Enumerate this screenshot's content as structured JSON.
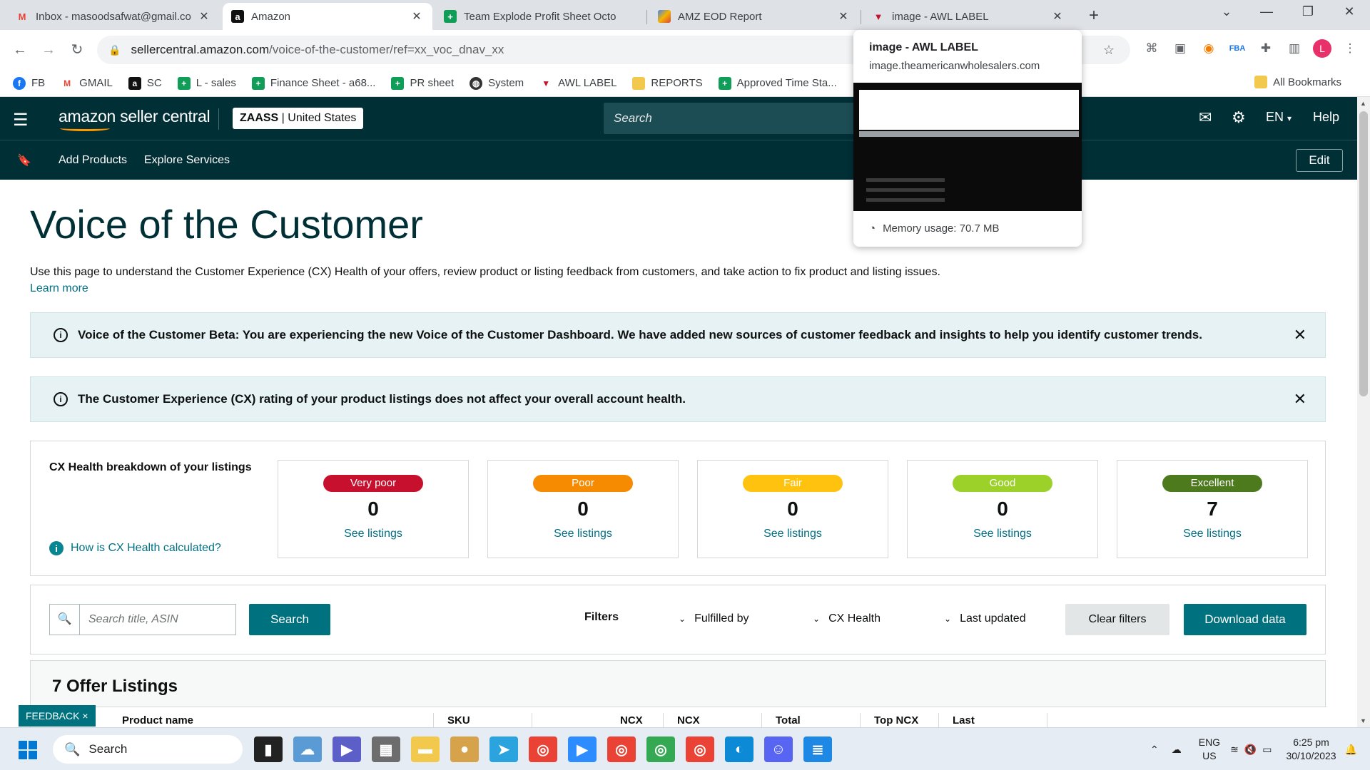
{
  "tabs": [
    {
      "title": "Inbox - masoodsafwat@gmail.com",
      "favicon": "gmail-icon",
      "active": false
    },
    {
      "title": "Amazon",
      "favicon": "amazon-icon",
      "active": true
    },
    {
      "title": "Team Explode Profit Sheet Octob",
      "favicon": "sheets-icon",
      "active": false
    },
    {
      "title": "AMZ EOD Report",
      "favicon": "report-icon",
      "active": false
    },
    {
      "title": "image - AWL LABEL",
      "favicon": "awl-icon",
      "active": false
    }
  ],
  "address": {
    "host": "sellercentral.amazon.com",
    "path": "/voice-of-the-customer/ref=xx_voc_dnav_xx"
  },
  "bookmarks": [
    {
      "label": "FB",
      "icon": "facebook-icon",
      "color": "#1877f2"
    },
    {
      "label": "GMAIL",
      "icon": "gmail-icon",
      "color": "#ea4335"
    },
    {
      "label": "SC",
      "icon": "amazon-icon",
      "color": "#111111"
    },
    {
      "label": "L - sales",
      "icon": "sheets-icon",
      "color": "#0f9d58"
    },
    {
      "label": "Finance Sheet - a68...",
      "icon": "sheets-icon",
      "color": "#0f9d58"
    },
    {
      "label": "PR sheet",
      "icon": "sheets-icon",
      "color": "#0f9d58"
    },
    {
      "label": "System",
      "icon": "globe-icon",
      "color": "#333333"
    },
    {
      "label": "AWL LABEL",
      "icon": "awl-icon",
      "color": "#c4122f"
    },
    {
      "label": "REPORTS",
      "icon": "folder-icon",
      "color": "#f2c94c"
    },
    {
      "label": "Approved Time Sta...",
      "icon": "sheets-icon",
      "color": "#0f9d58"
    }
  ],
  "bookmarks_all": "All Bookmarks",
  "hovercard": {
    "title": "image - AWL LABEL",
    "url": "image.theamericanwholesalers.com",
    "memory": "Memory usage: 70.7 MB"
  },
  "header": {
    "logo_text": "amazon seller central",
    "store_name": "ZAASS",
    "store_region": "United States",
    "search_placeholder": "Search",
    "language": "EN",
    "help": "Help"
  },
  "subnav": {
    "items": [
      "Add Products",
      "Explore Services"
    ],
    "edit": "Edit"
  },
  "page": {
    "title": "Voice of the Customer",
    "description": "Use this page to understand the Customer Experience (CX) Health of your offers, review product or listing feedback from customers, and take action to fix product and listing issues.",
    "learn_more": "Learn more"
  },
  "alerts": [
    "Voice of the Customer Beta: You are experiencing the new Voice of the Customer Dashboard. We have added new sources of customer feedback and insights to help you identify customer trends.",
    "The Customer Experience (CX) rating of your product listings does not affect your overall account health."
  ],
  "cx": {
    "title": "CX Health breakdown of your listings",
    "help_link": "How is CX Health calculated?",
    "link_label": "See listings",
    "cards": [
      {
        "label": "Very poor",
        "count": "0",
        "color": "#c7102e"
      },
      {
        "label": "Poor",
        "count": "0",
        "color": "#f68a00"
      },
      {
        "label": "Fair",
        "count": "0",
        "color": "#ffc20e"
      },
      {
        "label": "Good",
        "count": "0",
        "color": "#9cd12a"
      },
      {
        "label": "Excellent",
        "count": "7",
        "color": "#4c7a1c"
      }
    ]
  },
  "search": {
    "placeholder": "Search title, ASIN",
    "button": "Search",
    "filters_label": "Filters",
    "filters": [
      "Fulfilled by",
      "CX Health",
      "Last updated"
    ],
    "clear": "Clear filters",
    "download": "Download data"
  },
  "offers": {
    "title": "7 Offer Listings",
    "columns": [
      "Product name",
      "SKU",
      "NCX",
      "NCX",
      "Total",
      "Top NCX",
      "Last"
    ]
  },
  "feedback_tab": "FEEDBACK ×",
  "taskbar": {
    "search": "Search",
    "lang_top": "ENG",
    "lang_bottom": "US",
    "time": "6:25 pm",
    "date": "30/10/2023"
  }
}
